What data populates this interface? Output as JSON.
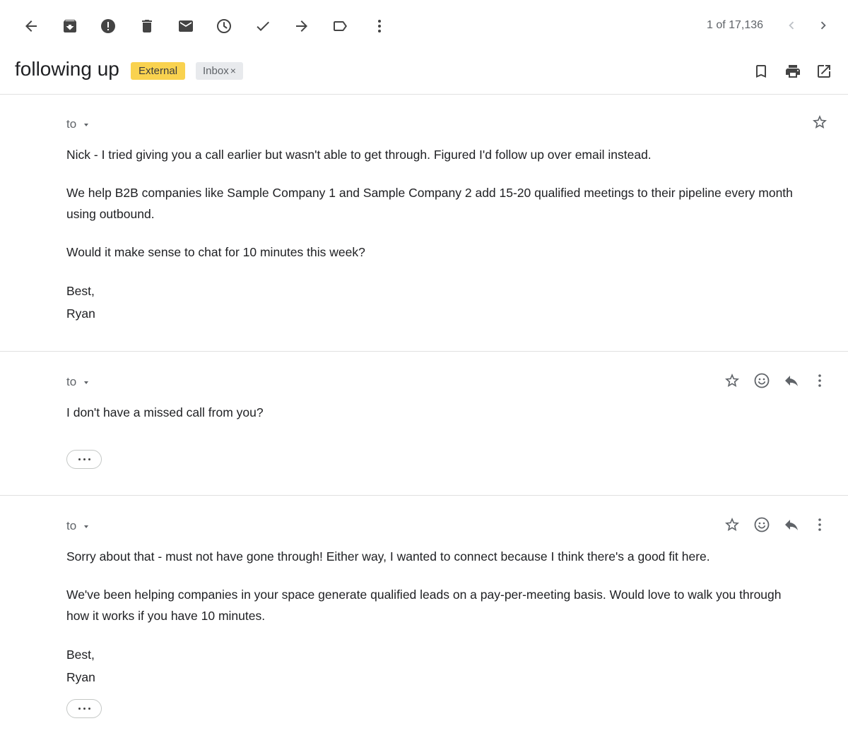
{
  "toolbar": {
    "icons": [
      "back-arrow-icon",
      "archive-icon",
      "report-spam-icon",
      "delete-icon",
      "mark-unread-icon",
      "snooze-icon",
      "mark-done-icon",
      "forward-arrow-icon",
      "label-icon",
      "more-vert-icon"
    ],
    "pager_text": "1 of 17,136"
  },
  "subject": {
    "title": "following up",
    "labels": [
      {
        "text": "External",
        "color": "#f9d24f"
      },
      {
        "text": "Inbox",
        "close": "×",
        "color": "#e8eaed"
      }
    ]
  },
  "messages": [
    {
      "to_label": "to",
      "paragraphs": [
        "Nick - I tried giving you a call earlier but wasn't able to get through. Figured I'd follow up over email instead.",
        "We help B2B companies like Sample Company 1 and Sample Company 2 add 15-20 qualified meetings to their pipeline every month using outbound.",
        "Would it make sense to chat for 10 minutes this week?"
      ],
      "signature": [
        "Best,",
        "Ryan"
      ]
    },
    {
      "to_label": "to",
      "paragraphs": [
        "I don't have a missed call from you?"
      ]
    },
    {
      "to_label": "to",
      "paragraphs": [
        "Sorry about that - must not have gone through! Either way, I wanted to connect because I think there's a good fit here.",
        "We've been helping companies in your space generate qualified leads on a pay-per-meeting basis. Would love to walk you through how it works if you have 10 minutes."
      ],
      "signature": [
        "Best,",
        "Ryan"
      ]
    }
  ],
  "colors": {
    "accent_external": "#f9d24f",
    "icon_gray": "#5f6368",
    "divider": "#e0e0e0"
  }
}
